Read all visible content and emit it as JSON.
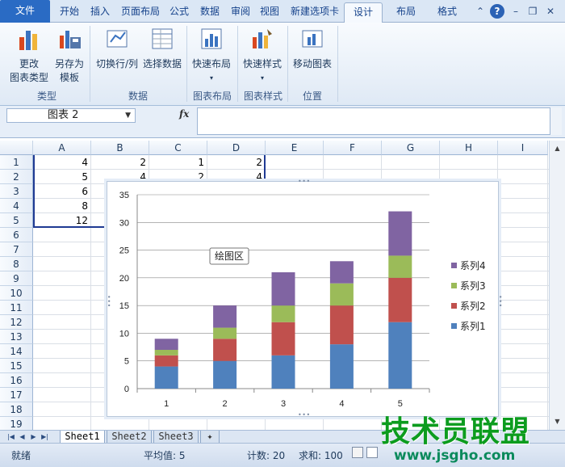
{
  "tabs": [
    "文件",
    "开始",
    "插入",
    "页面布局",
    "公式",
    "数据",
    "审阅",
    "视图",
    "新建选项卡",
    "设计",
    "布局",
    "格式"
  ],
  "ribbon": {
    "buttons": [
      {
        "label1": "更改",
        "label2": "图表类型"
      },
      {
        "label1": "另存为",
        "label2": "模板"
      },
      {
        "label1": "切换行/列",
        "label2": ""
      },
      {
        "label1": "选择数据",
        "label2": ""
      },
      {
        "label1": "快速布局",
        "label2": ""
      },
      {
        "label1": "快速样式",
        "label2": ""
      },
      {
        "label1": "移动图表",
        "label2": ""
      }
    ],
    "groups": [
      "类型",
      "数据",
      "图表布局",
      "图表样式",
      "位置"
    ]
  },
  "formula_bar": {
    "name_box": "图表 2",
    "fx": "fx"
  },
  "columns": [
    "A",
    "B",
    "C",
    "D",
    "E",
    "F",
    "G",
    "H",
    "I"
  ],
  "rows": [
    "1",
    "2",
    "3",
    "4",
    "5",
    "6",
    "7",
    "8",
    "9",
    "10",
    "11",
    "12",
    "13",
    "14",
    "15",
    "16",
    "17",
    "18",
    "19"
  ],
  "cells": [
    [
      "4",
      "2",
      "1",
      "2"
    ],
    [
      "5",
      "4",
      "2",
      "4"
    ],
    [
      "6",
      ""
    ],
    [
      "8",
      ""
    ],
    [
      "12",
      ""
    ]
  ],
  "chart_data": {
    "type": "bar",
    "stacked": true,
    "categories": [
      "1",
      "2",
      "3",
      "4",
      "5"
    ],
    "series": [
      {
        "name": "系列1",
        "values": [
          4,
          5,
          6,
          8,
          12
        ],
        "color": "#4f81bd"
      },
      {
        "name": "系列2",
        "values": [
          2,
          4,
          6,
          7,
          8
        ],
        "color": "#c0504d"
      },
      {
        "name": "系列3",
        "values": [
          1,
          2,
          3,
          4,
          4
        ],
        "color": "#9bbb59"
      },
      {
        "name": "系列4",
        "values": [
          2,
          4,
          6,
          4,
          8
        ],
        "color": "#8064a2"
      }
    ],
    "ylim": [
      0,
      35
    ],
    "yticks": [
      0,
      5,
      10,
      15,
      20,
      25,
      30,
      35
    ],
    "grid": true,
    "legend": "right",
    "legend_order": [
      "系列4",
      "系列3",
      "系列2",
      "系列1"
    ],
    "tooltip": "绘图区"
  },
  "sheets": [
    "Sheet1",
    "Sheet2",
    "Sheet3"
  ],
  "status": {
    "ready": "就绪",
    "average": "平均值: 5",
    "count": "计数: 20",
    "sum": "求和: 100"
  },
  "watermark": {
    "main": "技术员联盟",
    "url": "www.jsgho.com"
  }
}
